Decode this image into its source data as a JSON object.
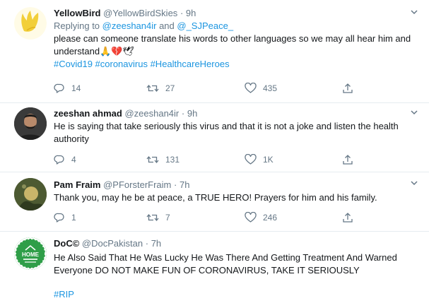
{
  "tweets": [
    {
      "name": "YellowBird",
      "handle": "@YellowBirdSkies",
      "dot": "·",
      "time": "9h",
      "replying_prefix": "Replying to ",
      "replying_to_1": "@zeeshan4ir",
      "replying_and": " and ",
      "replying_to_2": "@_SJPeace_",
      "text": "please can someone translate his words to other languages so we may all hear him and understand🙏💔🕊",
      "hashtags": "#Covid19 #coronavirus #HealthcareHeroes",
      "replies": "14",
      "retweets": "27",
      "likes": "435"
    },
    {
      "name": "zeeshan ahmad",
      "handle": "@zeeshan4ir",
      "dot": "·",
      "time": "9h",
      "text": "He is saying that take seriously this virus and that it is not a  joke and listen the health authority",
      "replies": "4",
      "retweets": "131",
      "likes": "1K"
    },
    {
      "name": "Pam Fraim",
      "handle": "@PForsterFraim",
      "dot": "·",
      "time": "7h",
      "text": "Thank you, may he be at peace, a TRUE HERO! Prayers for him and his family.",
      "replies": "1",
      "retweets": "7",
      "likes": "246"
    },
    {
      "name": "DoC©",
      "handle": "@DocPakistan",
      "dot": "·",
      "time": "7h",
      "text": "He Also Said That He Was Lucky He Was There And Getting Treatment And Warned Everyone DO NOT MAKE FUN OF CORONAVIRUS, TAKE IT SERIOUSLY",
      "hashtag": "#RIP",
      "avatar_text": "HOME"
    }
  ],
  "icons": {
    "reply": "reply-icon",
    "retweet": "retweet-icon",
    "like": "heart-icon",
    "share": "share-icon",
    "caret": "chevron-down-icon"
  },
  "colors": {
    "link": "#1b95e0",
    "secondary_text": "#657786",
    "icon": "#657786",
    "divider": "#e6ecf0"
  }
}
